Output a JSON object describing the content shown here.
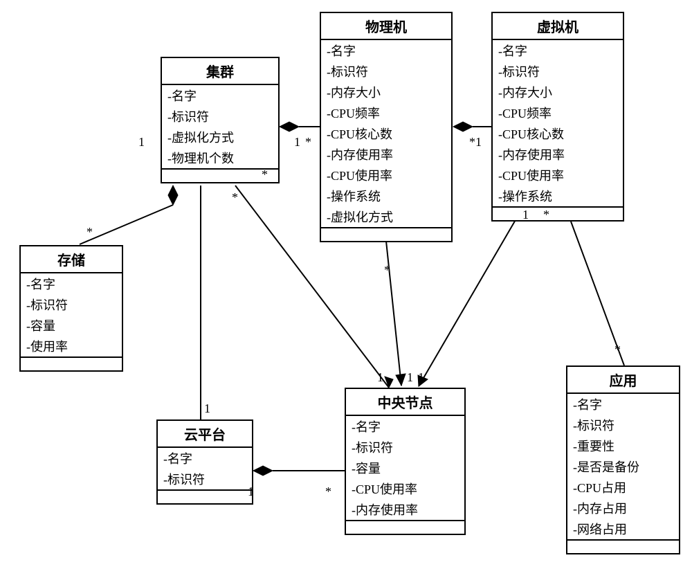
{
  "classes": {
    "physical": {
      "title": "物理机",
      "attrs": [
        "名字",
        "标识符",
        "内存大小",
        "CPU频率",
        "CPU核心数",
        "内存使用率",
        "CPU使用率",
        "操作系统",
        "虚拟化方式"
      ]
    },
    "virtual": {
      "title": "虚拟机",
      "attrs": [
        "名字",
        "标识符",
        "内存大小",
        "CPU频率",
        "CPU核心数",
        "内存使用率",
        "CPU使用率",
        "操作系统"
      ]
    },
    "cluster": {
      "title": "集群",
      "attrs": [
        "名字",
        "标识符",
        "虚拟化方式",
        "物理机个数"
      ]
    },
    "storage": {
      "title": "存储",
      "attrs": [
        "名字",
        "标识符",
        "容量",
        "使用率"
      ]
    },
    "cloud": {
      "title": "云平台",
      "attrs": [
        "名字",
        "标识符"
      ]
    },
    "central": {
      "title": "中央节点",
      "attrs": [
        "名字",
        "标识符",
        "容量",
        "CPU使用率",
        "内存使用率"
      ]
    },
    "app": {
      "title": "应用",
      "attrs": [
        "名字",
        "标识符",
        "重要性",
        "是否是备份",
        "CPU占用",
        "内存占用",
        "网络占用"
      ]
    }
  },
  "mult": {
    "cluster_left_top": "1",
    "cluster_left_bottom": "*",
    "cluster_right_top": "1",
    "cluster_right_star": "*",
    "cluster_bottom_star": "*",
    "cluster_cloud_1": "1",
    "phys_left_star": "*",
    "phys_right_1star": "*1",
    "phys_bottom_star": "*",
    "vm_bottom_1": "1",
    "vm_bottom_star": "*",
    "central_top_1l": "1",
    "central_top_1m": "1",
    "central_top_1r": "1",
    "cloud_1": "1",
    "cloud_star": "*",
    "app_star": "*"
  }
}
